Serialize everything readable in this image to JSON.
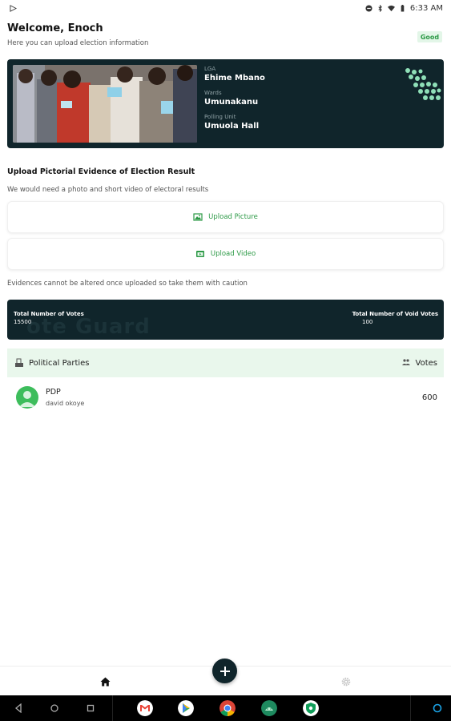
{
  "status_bar": {
    "time": "6:33 AM"
  },
  "header": {
    "welcome": "Welcome, Enoch",
    "subtitle": "Here you can upload election information",
    "status_badge": "Good"
  },
  "info_card": {
    "lga_label": "LGA",
    "lga_value": "Ehime Mbano",
    "wards_label": "Wards",
    "wards_value": "Umunakanu",
    "polling_unit_label": "Polling Unit",
    "polling_unit_value": "Umuola Hall"
  },
  "upload": {
    "title": "Upload Pictorial Evidence of Election Result",
    "subtitle": "We would need a photo and short video of electoral results",
    "picture_label": "Upload Picture",
    "video_label": "Upload Video",
    "caution": "Evidences cannot be altered once uploaded so take them with caution"
  },
  "votes_summary": {
    "watermark": "ote Guard",
    "total_votes_label": "Total Number of Votes",
    "total_votes_value": "15500",
    "void_votes_label": "Total Number of Void Votes",
    "void_votes_value": "100"
  },
  "parties": {
    "header_label": "Political Parties",
    "votes_label": "Votes",
    "rows": [
      {
        "party": "PDP",
        "candidate": "david okoye",
        "votes": "600"
      }
    ]
  },
  "colors": {
    "accent_green": "#2d9a47",
    "dark_card": "#10252b",
    "light_green": "#e9f7ec",
    "avatar_green": "#3dbd5c"
  },
  "icons": {
    "upload_picture": "image-icon",
    "upload_video": "video-icon",
    "parties": "ballot-icon",
    "votes": "people-icon",
    "nav_home": "home-icon",
    "nav_settings": "gear-icon",
    "fab": "plus-icon"
  }
}
